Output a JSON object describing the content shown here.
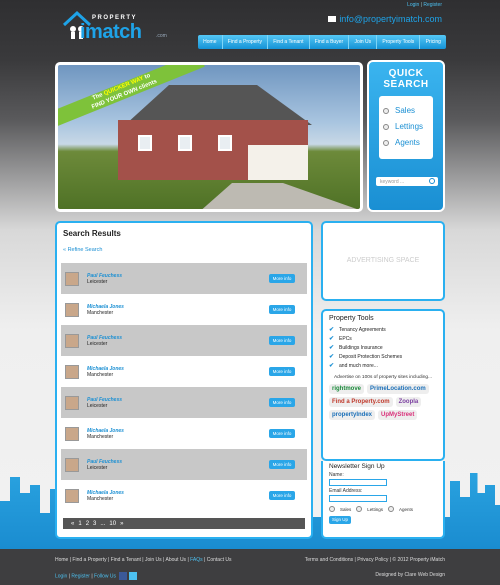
{
  "header": {
    "login": "Login",
    "register": "Register",
    "logo_top": "PROPERTY",
    "logo_brand": "imatch",
    "logo_dotcom": ".com",
    "email": "info@propertyimatch.com"
  },
  "nav": [
    "Home",
    "Find a Property",
    "Find a Tenant",
    "Find a Buyer",
    "Join Us",
    "Property Tools",
    "Pricing"
  ],
  "hero": {
    "banner_1": "The",
    "banner_quick": "QUICKER WAY",
    "banner_2": "to",
    "banner_3": "FIND YOUR OWN",
    "banner_4": "clients"
  },
  "quick_search": {
    "title": "QUICK SEARCH",
    "options": [
      "Sales",
      "Lettings",
      "Agents"
    ],
    "keyword_placeholder": "keyword ..."
  },
  "results": {
    "title": "Search Results",
    "refine": "« Refine Search",
    "more_label": "More info",
    "rows": [
      {
        "name": "Paul Feuchess",
        "location": "Leicester"
      },
      {
        "name": "Michaela Jones",
        "location": "Manchester"
      },
      {
        "name": "Paul Feuchess",
        "location": "Leicester"
      },
      {
        "name": "Michaela Jones",
        "location": "Manchester"
      },
      {
        "name": "Paul Feuchess",
        "location": "Leicester"
      },
      {
        "name": "Michaela Jones",
        "location": "Manchester"
      },
      {
        "name": "Paul Feuchess",
        "location": "Leicester"
      },
      {
        "name": "Michaela Jones",
        "location": "Manchester"
      }
    ],
    "pager": [
      "«",
      "1",
      "2",
      "3",
      "...",
      "10",
      "»"
    ]
  },
  "advertising": "ADVERTISING SPACE",
  "tools": {
    "title": "Property Tools",
    "items": [
      "Tenancy Agreements",
      "EPCs",
      "Buildings Insurance",
      "Deposit Protection Schemes",
      "and much more..."
    ],
    "advertise": "Advertise on 100s of property sites including...",
    "sites": [
      "rightmove",
      "PrimeLocation.com",
      "Find a Property.com",
      "Zoopla",
      "propertyIndex",
      "UpMyStreet"
    ]
  },
  "newsletter": {
    "title": "Newsletter Sign Up",
    "name_label": "Name:",
    "email_label": "Email Address:",
    "types": [
      "Sales",
      "Lettings",
      "Agents"
    ],
    "submit": "Sign Up"
  },
  "footer": {
    "links": [
      "Home",
      "Find a Property",
      "Find a Tenant",
      "Join Us",
      "About Us",
      "FAQs",
      "Contact Us"
    ],
    "right1": "Terms and Conditions | Privacy Policy | © 2012 Property iMatch",
    "login": "Login",
    "register": "Register",
    "follow": "Follow Us",
    "designed": "Designed by Clare Web Design"
  },
  "colors": {
    "accent": "#1ea3e8",
    "dark": "#3e3e40",
    "green": "#7ec23a"
  }
}
